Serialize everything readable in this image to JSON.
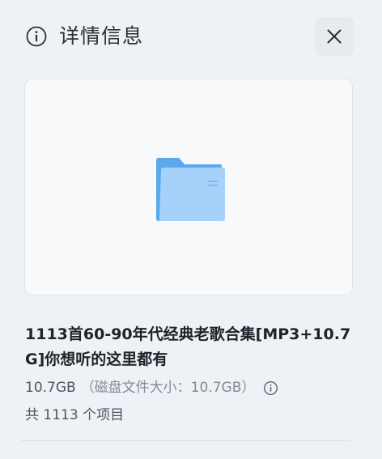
{
  "header": {
    "title": "详情信息",
    "info_icon": "info-circle-icon",
    "close_icon": "close-icon"
  },
  "preview": {
    "icon": "folder-icon",
    "colors": {
      "folder_back": "#5aa9ee",
      "folder_front": "#a6d1fb"
    }
  },
  "file": {
    "name": "1113首60-90年代经典老歌合集[MP3+10.7G]你想听的这里都有",
    "size": "10.7GB",
    "disk_size": "（磁盘文件大小：10.7GB）",
    "item_count": "共 1113 个项目"
  }
}
